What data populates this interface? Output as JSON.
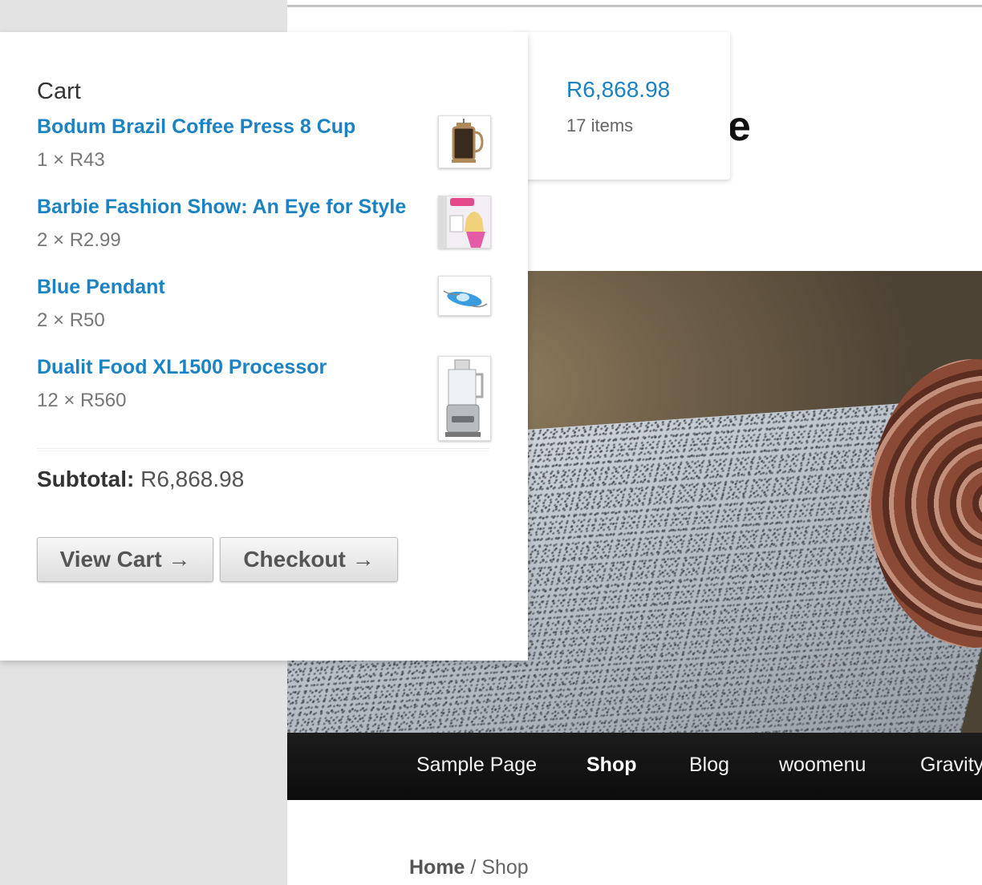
{
  "site": {
    "title_fragment": "ce",
    "nav": [
      {
        "label": "Sample Page",
        "active": false
      },
      {
        "label": "Shop",
        "active": true
      },
      {
        "label": "Blog",
        "active": false
      },
      {
        "label": "woomenu",
        "active": false
      },
      {
        "label": "Gravity",
        "active": false
      }
    ],
    "breadcrumb": {
      "home": "Home",
      "separator": " / ",
      "current": "Shop"
    }
  },
  "cart_summary": {
    "total": "R6,868.98",
    "count": "17 items"
  },
  "mini_cart": {
    "title": "Cart",
    "items": [
      {
        "name": "Bodum Brazil Coffee Press 8 Cup",
        "qty": "1 × R43",
        "icon": "coffee-press-icon"
      },
      {
        "name": "Barbie Fashion Show: An Eye for Style",
        "qty": "2 × R2.99",
        "icon": "game-box-icon"
      },
      {
        "name": "Blue Pendant",
        "qty": "2 × R50",
        "icon": "pendant-icon"
      },
      {
        "name": "Dualit Food XL1500 Processor",
        "qty": "12 × R560",
        "icon": "food-processor-icon"
      }
    ],
    "subtotal_label": "Subtotal:",
    "subtotal_value": " R6,868.98",
    "view_cart_label": "View Cart →",
    "checkout_label": "Checkout →"
  },
  "colors": {
    "link": "#1b82c4",
    "nav_bg": "#111111"
  }
}
